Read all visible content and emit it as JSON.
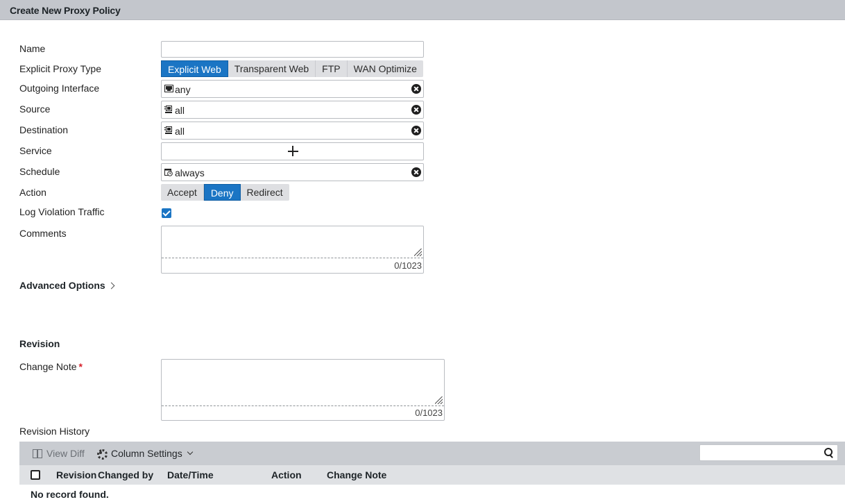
{
  "header": {
    "title": "Create New Proxy Policy"
  },
  "form": {
    "name": {
      "label": "Name",
      "value": ""
    },
    "proxy_type": {
      "label": "Explicit Proxy Type",
      "options": [
        "Explicit Web",
        "Transparent Web",
        "FTP",
        "WAN Optimize"
      ],
      "selected": "Explicit Web"
    },
    "outgoing_interface": {
      "label": "Outgoing Interface",
      "value": "any",
      "icon": "interface-icon"
    },
    "source": {
      "label": "Source",
      "value": "all",
      "icon": "address-icon"
    },
    "destination": {
      "label": "Destination",
      "value": "all",
      "icon": "address-icon"
    },
    "service": {
      "label": "Service",
      "icon": "add-icon"
    },
    "schedule": {
      "label": "Schedule",
      "value": "always",
      "icon": "schedule-icon"
    },
    "action": {
      "label": "Action",
      "options": [
        "Accept",
        "Deny",
        "Redirect"
      ],
      "selected": "Deny"
    },
    "log_violation": {
      "label": "Log Violation Traffic",
      "checked": true
    },
    "comments": {
      "label": "Comments",
      "value": "",
      "counter": "0/1023"
    },
    "advanced": {
      "label": "Advanced Options"
    }
  },
  "revision": {
    "heading": "Revision",
    "change_note": {
      "label": "Change Note",
      "required_mark": "*",
      "value": "",
      "counter": "0/1023"
    },
    "history_label": "Revision History",
    "toolbar": {
      "view_diff": "View Diff",
      "column_settings": "Column Settings"
    },
    "search": {
      "value": "",
      "placeholder": ""
    },
    "columns": [
      "Revision",
      "Changed by",
      "Date/Time",
      "Action",
      "Change Note"
    ],
    "empty_message": "No record found."
  },
  "colors": {
    "accent": "#1b75c4",
    "title_bar": "#c3c6cc",
    "required": "#d6202a"
  }
}
